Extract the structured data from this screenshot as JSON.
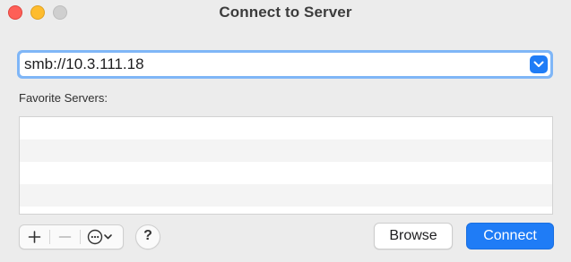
{
  "window": {
    "title": "Connect to Server"
  },
  "server_address": {
    "value": "smb://10.3.111.18"
  },
  "favorites": {
    "label": "Favorite Servers:",
    "items": []
  },
  "toolbar": {
    "add_icon": "plus-icon",
    "remove_icon": "minus-icon",
    "action_icon": "ellipsis-circle-icon",
    "help_label": "?"
  },
  "buttons": {
    "browse_label": "Browse",
    "connect_label": "Connect"
  },
  "colors": {
    "accent": "#1f7cf6",
    "close": "#fe5f57",
    "minimize": "#febc2e",
    "zoom_disabled": "#cfcfcf"
  }
}
